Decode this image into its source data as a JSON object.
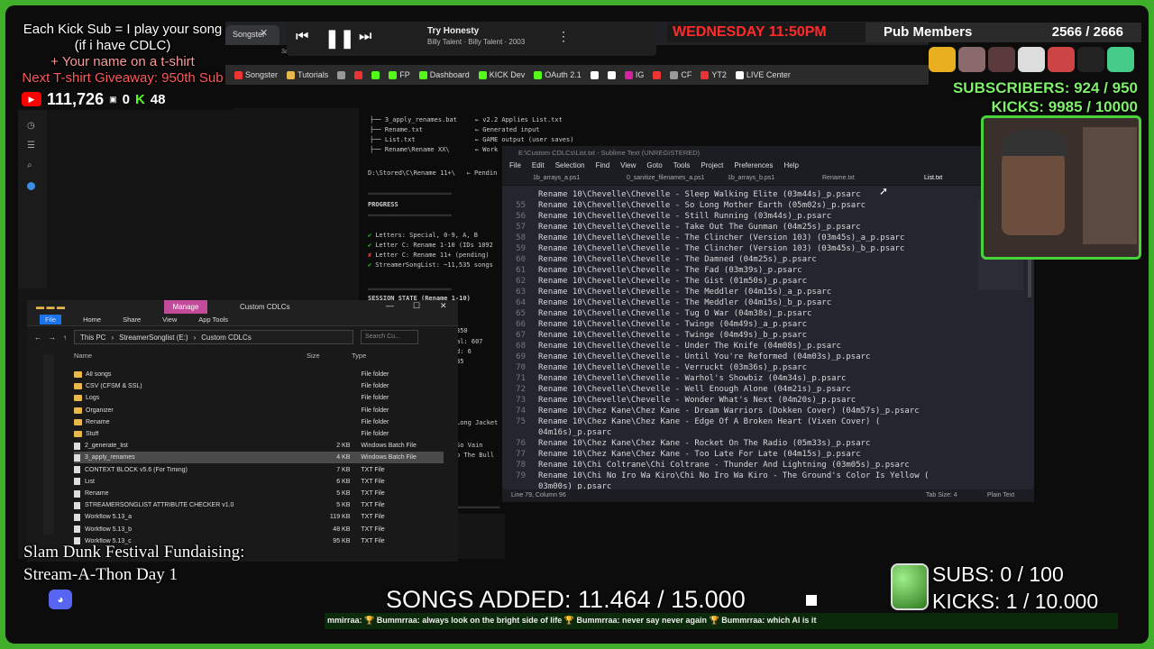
{
  "overlay": {
    "promo1": "Each Kick Sub = I play your song",
    "promo2": "(if i have CDLC)",
    "promo3": "+ Your name on a t-shirt",
    "promo4": "Next T-shirt Giveaway: 950th Sub",
    "youtube_count": "111,726",
    "small_count": "0",
    "kick_count": "48",
    "weekday_time": "WEDNESDAY 11:50PM",
    "pub_members_label": "Pub Members",
    "pub_members_value": "2566 / 2666",
    "subscribers": "SUBSCRIBERS: 924 / 950",
    "kicks": "KICKS: 9985 / 10000",
    "fundraiser1": "Slam Dunk Festival Fundaising:",
    "fundraiser2": "Stream-A-Thon Day 1",
    "songs_added": "SONGS ADDED: 11.464 / 15.000",
    "subs_goal": "SUBS:  0 / 100",
    "kicks_goal": "KICKS: 1 / 10.000",
    "ticker": "mmirraa: 🏆 Bummrraa: always look on the bright side of life 🏆 Bummrraa: never say never again 🏆 Bummrraa: which AI is it"
  },
  "music": {
    "title": "Try Honesty",
    "subtitle": "Billy Talent · Billy Talent · 2003"
  },
  "browser": {
    "tab1": "Songster",
    "tab_url_fragment": "3a-2e401403ce4",
    "bookmarks": [
      {
        "label": "Songster",
        "color": "#e33"
      },
      {
        "label": "Tutorials",
        "color": "#e8b84a"
      },
      {
        "label": "",
        "color": "#999"
      },
      {
        "label": "",
        "color": "#e33"
      },
      {
        "label": "",
        "color": "#53fc18"
      },
      {
        "label": "FP",
        "color": "#53fc18"
      },
      {
        "label": "Dashboard",
        "color": "#53fc18"
      },
      {
        "label": "KICK Dev",
        "color": "#53fc18"
      },
      {
        "label": "OAuth 2.1",
        "color": "#53fc18"
      },
      {
        "label": "",
        "color": "#fff"
      },
      {
        "label": "",
        "color": "#fff"
      },
      {
        "label": "IG",
        "color": "#d6249f"
      },
      {
        "label": "",
        "color": "#e33"
      },
      {
        "label": "CF",
        "color": "#999"
      },
      {
        "label": "YT2",
        "color": "#e33"
      },
      {
        "label": "LIVE Center",
        "color": "#fff"
      }
    ]
  },
  "terminal": {
    "files": [
      {
        "name": "3_apply_renames.bat",
        "desc": "v2.2 Applies List.txt"
      },
      {
        "name": "Rename.txt",
        "desc": "Generated input"
      },
      {
        "name": "List.txt",
        "desc": "GAME output (user saves)"
      },
      {
        "name": "Rename\\Rename XX\\",
        "desc": "Work"
      }
    ],
    "prompt": "D:\\Stored\\C\\Rename 11+\\",
    "pending": "Pendin",
    "progress_label": "PROGRESS",
    "progress_items": [
      {
        "mark": "✔",
        "text": "Letters: Special, 0-9, A, B"
      },
      {
        "mark": "✔",
        "text": "Letter C: Rename 1-10 (IDs 1092"
      },
      {
        "mark": "✘",
        "text": "Letter C: Rename 11+ (pending)"
      },
      {
        "mark": "✔",
        "text": "StreamerSongList: ~11,535 songs"
      }
    ],
    "session_label": "SESSION STATE (Rename 1-10)",
    "frag1": "350",
    "frag2": "al: 607",
    "frag3": "d: 6",
    "frag4": "35",
    "frag5": "Long Jacket",
    "frag6": "So Vain",
    "frag7": "o The Bull"
  },
  "sublime": {
    "title": "E:\\Custom CDLCs\\List.txt - Sublime Text (UNREGISTERED)",
    "menu": [
      "File",
      "Edit",
      "Selection",
      "Find",
      "View",
      "Goto",
      "Tools",
      "Project",
      "Preferences",
      "Help"
    ],
    "tabs": [
      "1b_arrays_a.ps1",
      "0_sanitize_filenames_a.ps1",
      "1b_arrays_b.ps1",
      "Rename.txt",
      "List.txt"
    ],
    "lines": [
      {
        "n": "",
        "t": "Rename 10\\Chevelle\\Chevelle - Sleep Walking Elite (03m44s)_p.psarc"
      },
      {
        "n": "55",
        "t": "Rename 10\\Chevelle\\Chevelle - So Long Mother Earth (05m02s)_p.psarc"
      },
      {
        "n": "56",
        "t": "Rename 10\\Chevelle\\Chevelle - Still Running (03m44s)_p.psarc"
      },
      {
        "n": "57",
        "t": "Rename 10\\Chevelle\\Chevelle - Take Out The Gunman (04m25s)_p.psarc"
      },
      {
        "n": "58",
        "t": "Rename 10\\Chevelle\\Chevelle - The Clincher (Version 103) (03m45s)_a_p.psarc"
      },
      {
        "n": "59",
        "t": "Rename 10\\Chevelle\\Chevelle - The Clincher (Version 103) (03m45s)_b_p.psarc"
      },
      {
        "n": "60",
        "t": "Rename 10\\Chevelle\\Chevelle - The Damned (04m25s)_p.psarc"
      },
      {
        "n": "61",
        "t": "Rename 10\\Chevelle\\Chevelle - The Fad (03m39s)_p.psarc"
      },
      {
        "n": "62",
        "t": "Rename 10\\Chevelle\\Chevelle - The Gist (01m50s)_p.psarc"
      },
      {
        "n": "63",
        "t": "Rename 10\\Chevelle\\Chevelle - The Meddler (04m15s)_a_p.psarc"
      },
      {
        "n": "64",
        "t": "Rename 10\\Chevelle\\Chevelle - The Meddler (04m15s)_b_p.psarc"
      },
      {
        "n": "65",
        "t": "Rename 10\\Chevelle\\Chevelle - Tug O War (04m38s)_p.psarc"
      },
      {
        "n": "66",
        "t": "Rename 10\\Chevelle\\Chevelle - Twinge (04m49s)_a_p.psarc"
      },
      {
        "n": "67",
        "t": "Rename 10\\Chevelle\\Chevelle - Twinge (04m49s)_b_p.psarc"
      },
      {
        "n": "68",
        "t": "Rename 10\\Chevelle\\Chevelle - Under The Knife (04m08s)_p.psarc"
      },
      {
        "n": "69",
        "t": "Rename 10\\Chevelle\\Chevelle - Until You're Reformed (04m03s)_p.psarc"
      },
      {
        "n": "70",
        "t": "Rename 10\\Chevelle\\Chevelle - Verruckt (03m36s)_p.psarc"
      },
      {
        "n": "71",
        "t": "Rename 10\\Chevelle\\Chevelle - Warhol's Showbiz (04m34s)_p.psarc"
      },
      {
        "n": "72",
        "t": "Rename 10\\Chevelle\\Chevelle - Well Enough Alone (04m21s)_p.psarc"
      },
      {
        "n": "73",
        "t": "Rename 10\\Chevelle\\Chevelle - Wonder What's Next (04m20s)_p.psarc"
      },
      {
        "n": "74",
        "t": "Rename 10\\Chez Kane\\Chez Kane - Dream Warriors (Dokken Cover) (04m57s)_p.psarc"
      },
      {
        "n": "75",
        "t": "Rename 10\\Chez Kane\\Chez Kane - Edge Of A Broken Heart (Vixen Cover) ("
      },
      {
        "n": "",
        "t": "04m16s)_p.psarc"
      },
      {
        "n": "76",
        "t": "Rename 10\\Chez Kane\\Chez Kane - Rocket On The Radio (05m33s)_p.psarc"
      },
      {
        "n": "77",
        "t": "Rename 10\\Chez Kane\\Chez Kane - Too Late For Late (04m15s)_p.psarc"
      },
      {
        "n": "78",
        "t": "Rename 10\\Chi Coltrane\\Chi Coltrane - Thunder And Lightning (03m05s)_p.psarc"
      },
      {
        "n": "79",
        "t": "Rename 10\\Chi No Iro Wa Kiro\\Chi No Iro Wa Kiro - The Ground's Color Is Yellow ("
      },
      {
        "n": "",
        "t": "03m00s)_p.psarc"
      }
    ],
    "status_pos": "Line 79, Column 96",
    "status_tab": "Tab Size: 4",
    "status_syntax": "Plain Text"
  },
  "explorer": {
    "manage": "Manage",
    "title": "Custom CDLCs",
    "ribbon": [
      "File",
      "Home",
      "Share",
      "View",
      "App Tools"
    ],
    "path": [
      "This PC",
      "StreamerSonglist (E:)",
      "Custom CDLCs"
    ],
    "search_placeholder": "Search Cu...",
    "col_name": "Name",
    "col_size": "Size",
    "col_type": "Type",
    "rows": [
      {
        "name": "All songs",
        "size": "",
        "type": "File folder",
        "kind": "folder"
      },
      {
        "name": "CSV (CFSM & SSL)",
        "size": "",
        "type": "File folder",
        "kind": "folder"
      },
      {
        "name": "Logs",
        "size": "",
        "type": "File folder",
        "kind": "folder"
      },
      {
        "name": "Organizer",
        "size": "",
        "type": "File folder",
        "kind": "folder"
      },
      {
        "name": "Rename",
        "size": "",
        "type": "File folder",
        "kind": "folder"
      },
      {
        "name": "Stuff",
        "size": "",
        "type": "File folder",
        "kind": "folder"
      },
      {
        "name": "2_generate_list",
        "size": "2 KB",
        "type": "Windows Batch File",
        "kind": "file"
      },
      {
        "name": "3_apply_renames",
        "size": "4 KB",
        "type": "Windows Batch File",
        "kind": "file"
      },
      {
        "name": "CONTEXT BLOCK v5.6 (For Timing)",
        "size": "7 KB",
        "type": "TXT File",
        "kind": "file"
      },
      {
        "name": "List",
        "size": "6 KB",
        "type": "TXT File",
        "kind": "file"
      },
      {
        "name": "Rename",
        "size": "5 KB",
        "type": "TXT File",
        "kind": "file"
      },
      {
        "name": "STREAMERSONGLIST ATTRIBUTE CHECKER v1.0",
        "size": "5 KB",
        "type": "TXT File",
        "kind": "file"
      },
      {
        "name": "Workflow 5.13_a",
        "size": "119 KB",
        "type": "TXT File",
        "kind": "file"
      },
      {
        "name": "Workflow 5.13_b",
        "size": "48 KB",
        "type": "TXT File",
        "kind": "file"
      },
      {
        "name": "Workflow 5.13_c",
        "size": "95 KB",
        "type": "TXT File",
        "kind": "file"
      }
    ]
  }
}
